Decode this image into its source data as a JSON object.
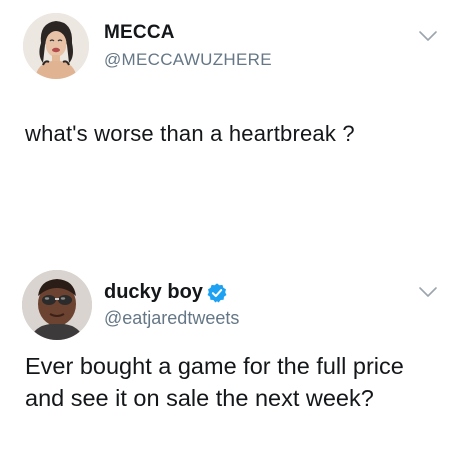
{
  "tweets": [
    {
      "name": "MECCA",
      "handle": "@MECCAWUZHERE",
      "text": "what's worse than a heartbreak ?",
      "verified": false,
      "avatar_icon": "avatar-sketch-woman-icon",
      "menu_icon": "chevron-down-icon"
    },
    {
      "name": "ducky boy",
      "handle": "@eatjaredtweets",
      "text": "Ever bought a game for the full price and see it on sale the next week?",
      "verified": true,
      "avatar_icon": "avatar-man-sunglasses-icon",
      "menu_icon": "chevron-down-icon"
    }
  ],
  "colors": {
    "text": "#14171a",
    "secondary": "#657786",
    "verified": "#1da1f2",
    "background": "#ffffff"
  }
}
